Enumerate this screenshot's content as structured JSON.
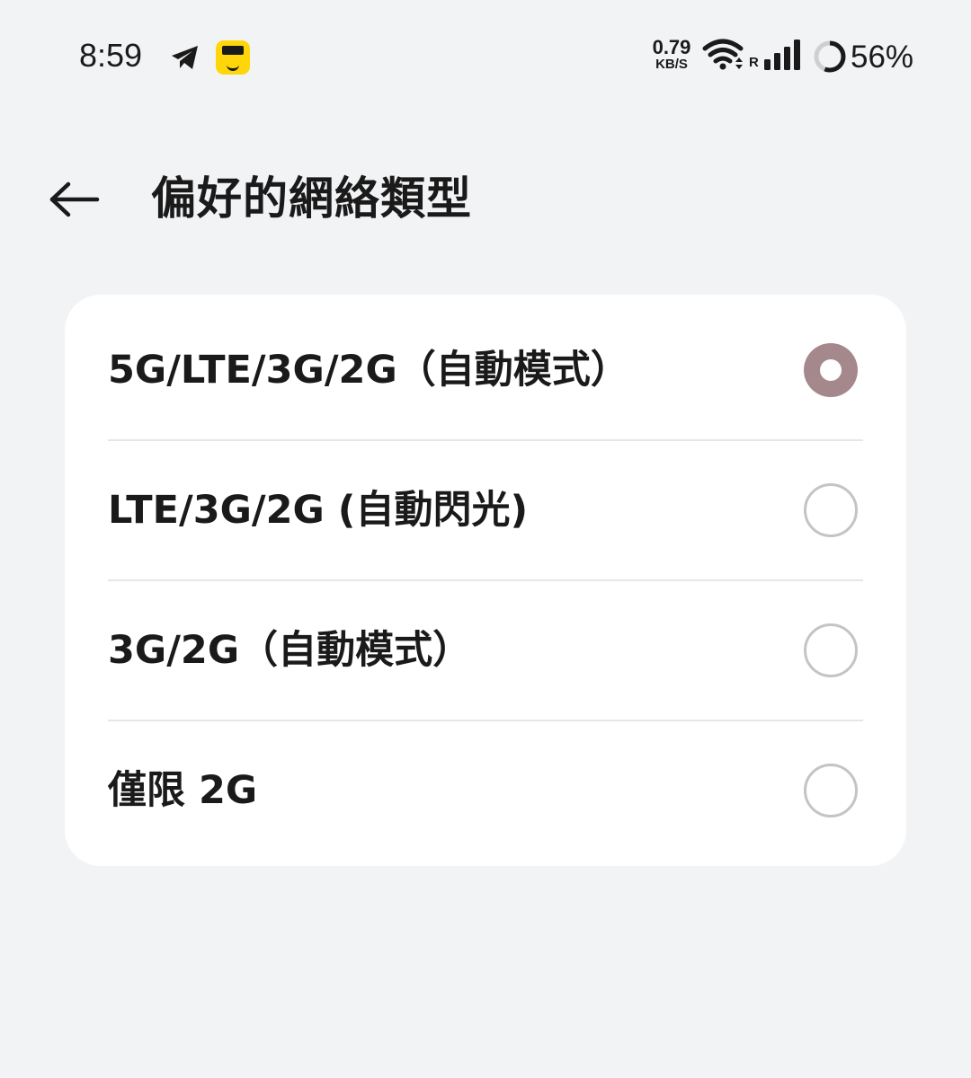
{
  "status_bar": {
    "time": "8:59",
    "icons": [
      "telegram-icon",
      "app-badge-icon",
      "wifi-icon",
      "signal-icon",
      "battery-ring-icon"
    ],
    "net_speed_value": "0.79",
    "net_speed_unit": "KB/S",
    "roaming_indicator": "R",
    "battery_percent": "56%",
    "battery_level": 0.56,
    "badge_color": "#ffd60a"
  },
  "header": {
    "back_icon": "back-arrow-icon",
    "title": "偏好的網絡類型"
  },
  "preferred_network": {
    "selected_index": 0,
    "accent_color": "#a4888c",
    "options": [
      {
        "label": "5G/LTE/3G/2G（自動模式）",
        "selected": true
      },
      {
        "label": "LTE/3G/2G (自動閃光)",
        "selected": false
      },
      {
        "label": "3G/2G（自動模式）",
        "selected": false
      },
      {
        "label": "僅限 2G",
        "selected": false
      }
    ]
  }
}
